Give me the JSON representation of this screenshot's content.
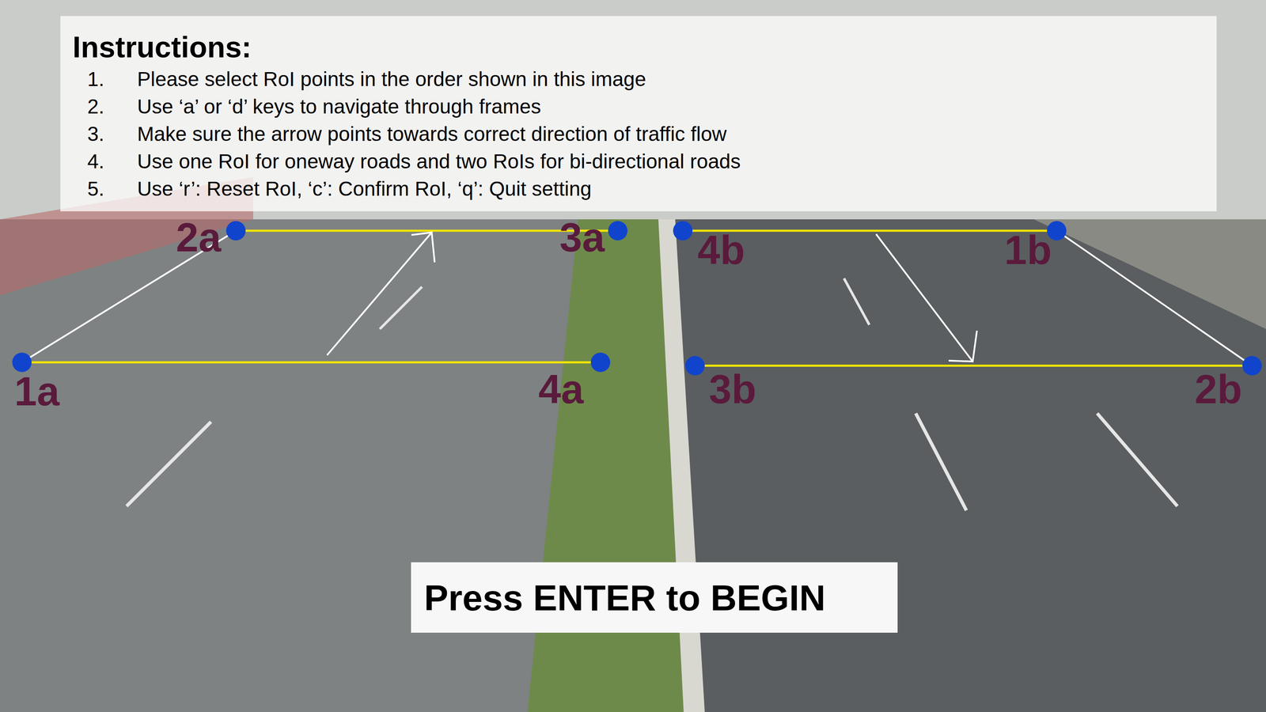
{
  "instructions": {
    "title": "Instructions:",
    "items": [
      {
        "number": "1.",
        "text": "Please select RoI points in the order shown in this image"
      },
      {
        "number": "2.",
        "text": "Use ‘a’ or ‘d’ keys to navigate through frames"
      },
      {
        "number": "3.",
        "text": "Make sure the arrow points towards correct direction of traffic flow"
      },
      {
        "number": "4.",
        "text": "Use one RoI for oneway roads and two RoIs for bi-directional roads"
      },
      {
        "number": "5.",
        "text": "Use ‘r’: Reset RoI, ‘c’: Confirm RoI, ‘q’: Quit setting"
      }
    ]
  },
  "roi_points": [
    {
      "label": "1a"
    },
    {
      "label": "2a"
    },
    {
      "label": "3a"
    },
    {
      "label": "4a"
    },
    {
      "label": "1b"
    },
    {
      "label": "2b"
    },
    {
      "label": "3b"
    },
    {
      "label": "4b"
    }
  ],
  "button": {
    "label": "Press ENTER to BEGIN"
  }
}
